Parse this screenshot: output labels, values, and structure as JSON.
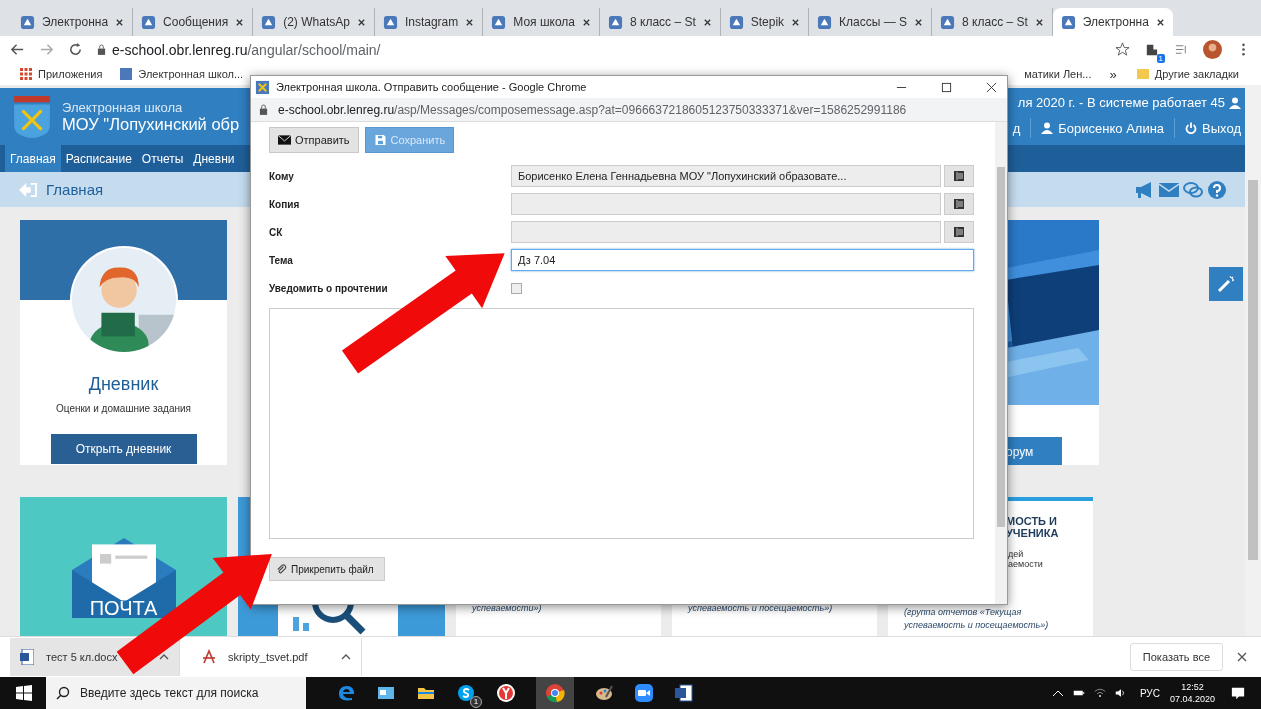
{
  "browser": {
    "tabs": [
      {
        "label": "Электронна",
        "selected": false
      },
      {
        "label": "Сообщения",
        "selected": false
      },
      {
        "label": "(2) WhatsAp",
        "selected": false
      },
      {
        "label": "Instagram",
        "selected": false
      },
      {
        "label": "Моя школа",
        "selected": false
      },
      {
        "label": "8 класс – St",
        "selected": false
      },
      {
        "label": "Stepik",
        "selected": false
      },
      {
        "label": "Классы — S",
        "selected": false
      },
      {
        "label": "8 класс – St",
        "selected": false
      },
      {
        "label": "Электронна",
        "selected": true
      }
    ],
    "url_host": "e-school.obr.lenreg.ru",
    "url_path": "/angular/school/main/",
    "extension_badge": "1",
    "bookmarks": [
      "Приложения",
      "Электронная школ..."
    ],
    "bookmarks_right": "матики Лен...",
    "overflow": "»",
    "other_bookmarks": "Другие закладки"
  },
  "page": {
    "site_name": "Электронная школа",
    "school": "МОУ \"Лопухинский обр",
    "info": "ля 2020 г. - В системе работает 45",
    "cut_link": "д",
    "user": "Борисенко Алина",
    "logout": "Выход",
    "menu": [
      {
        "label": "Главная",
        "selected": true
      },
      {
        "label": "Расписание",
        "selected": false
      },
      {
        "label": "Отчеты",
        "selected": false
      },
      {
        "label": "Дневни",
        "selected": false
      }
    ],
    "breadcrumb": "Главная",
    "row_1": [
      {
        "kind": "diary",
        "title": "Дневник",
        "subtitle": "Оценки и домашние задания",
        "button": "Открыть дневник"
      },
      {
        "kind": "forum",
        "button": "орум"
      }
    ],
    "row_2": [
      {
        "kind": "mail",
        "label": "ПОЧТА"
      },
      {
        "kind": "search"
      },
      {
        "kind": "report",
        "note_lines": [
          "успеваемости»)"
        ]
      },
      {
        "kind": "report",
        "note_lines": [
          "успеваемость и посещаемость»)"
        ]
      },
      {
        "kind": "report",
        "title_lines": [
          "МОСТЬ И",
          "УЧЕНИКА"
        ],
        "text_lines": [
          "дей",
          "аемости"
        ],
        "note_lines": [
          "(группа отчетов «Текущая",
          "успеваемость и посещаемость»)"
        ]
      }
    ]
  },
  "popup": {
    "title": "Электронная школа. Отправить сообщение - Google Chrome",
    "url_host": "e-school.obr.lenreg.ru",
    "url_path": "/asp/Messages/composemessage.asp?at=0966637218605123750333371&ver=1586252991186",
    "buttons": [
      {
        "kind": "send",
        "label": "Отправить",
        "disabled": false
      },
      {
        "kind": "save",
        "label": "Сохранить",
        "disabled": true
      }
    ],
    "fields": [
      {
        "kind": "address",
        "label": "Кому",
        "value": "Борисенко Елена Геннадьевна МОУ \"Лопухинский образовате...",
        "focused": false
      },
      {
        "kind": "address",
        "label": "Копия",
        "focused": false
      },
      {
        "kind": "address",
        "label": "СК",
        "focused": false
      },
      {
        "kind": "text",
        "label": "Тема",
        "value": "Дз 7.04",
        "focused": true
      },
      {
        "kind": "checkbox",
        "label": "Уведомить о прочтении",
        "checked": false
      }
    ],
    "attach": "Прикрепить файл"
  },
  "downloads": {
    "items": [
      {
        "kind": "docx",
        "name": "тест 5 кл.docx"
      },
      {
        "kind": "pdf",
        "name": "skripty_tsvet.pdf"
      }
    ],
    "show_all": "Показать все"
  },
  "taskbar": {
    "search_placeholder": "Введите здесь текст для поиска",
    "skype_badge": "1",
    "language": "РУС",
    "time": "12:52",
    "date": "07.04.2020"
  }
}
